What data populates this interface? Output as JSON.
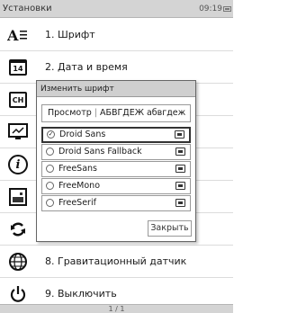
{
  "status": {
    "title": "Установки",
    "time": "09:19"
  },
  "menu": {
    "items": [
      {
        "label": "1. Шрифт"
      },
      {
        "label": "2. Дата и время"
      },
      {
        "label": ""
      },
      {
        "label": ""
      },
      {
        "label": ""
      },
      {
        "label": ""
      },
      {
        "label": ""
      },
      {
        "label": "8. Гравитационный датчик"
      },
      {
        "label": "9. Выключить"
      }
    ],
    "icon_texts": {
      "calendar": "14",
      "ch": "CH"
    }
  },
  "dialog": {
    "title": "Изменить шрифт",
    "preview_label": "Просмотр",
    "preview_sample": "АБВГДЕЖ абвгдеж",
    "fonts": [
      {
        "name": "Droid Sans",
        "selected": true
      },
      {
        "name": "Droid Sans Fallback",
        "selected": false
      },
      {
        "name": "FreeSans",
        "selected": false
      },
      {
        "name": "FreeMono",
        "selected": false
      },
      {
        "name": "FreeSerif",
        "selected": false
      }
    ],
    "close_label": "Закрыть"
  },
  "footer": {
    "page": "1 / 1"
  }
}
